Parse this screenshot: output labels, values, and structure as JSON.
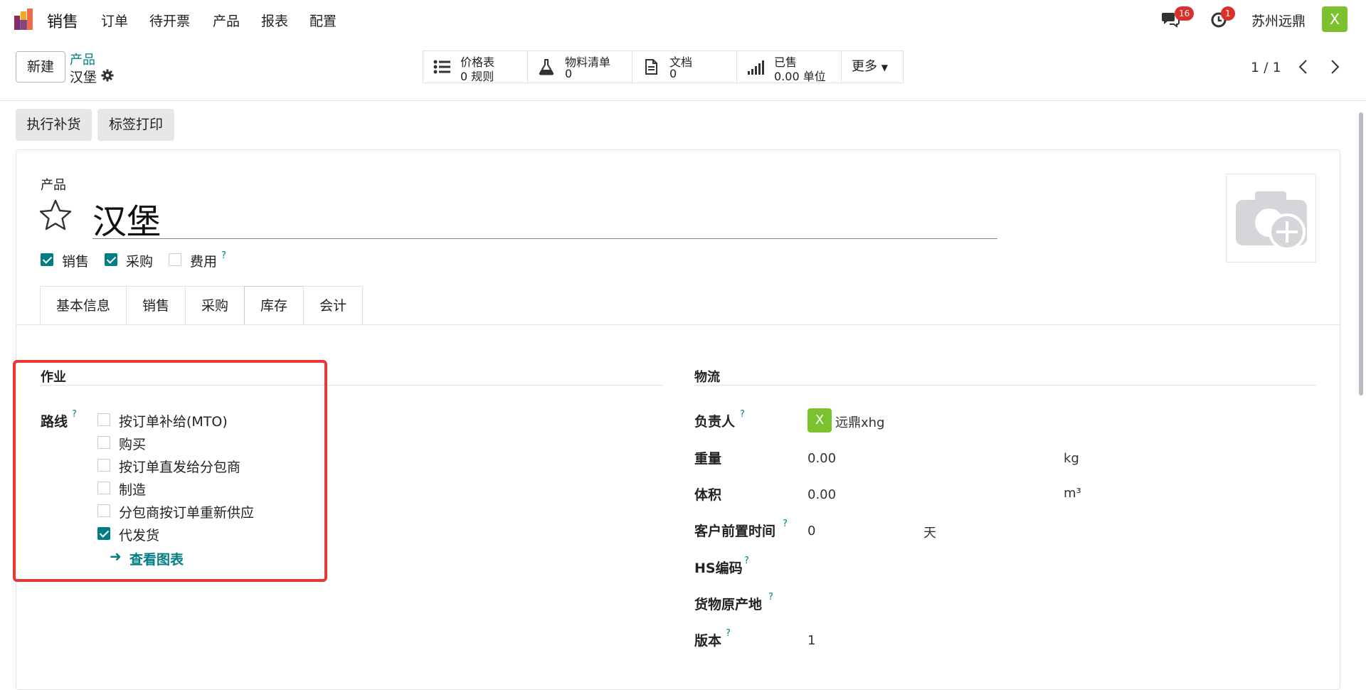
{
  "topnav": {
    "app": "销售",
    "menu": [
      "订单",
      "待开票",
      "产品",
      "报表",
      "配置"
    ],
    "messages_badge": "16",
    "activities_badge": "1",
    "company": "苏州远鼎",
    "user_initial": "X"
  },
  "control": {
    "new_button": "新建",
    "breadcrumb_parent": "产品",
    "breadcrumb_current": "汉堡",
    "smart_buttons": [
      {
        "label": "价格表",
        "value": "0 规则",
        "icon": "list-icon"
      },
      {
        "label": "物料清单",
        "value": "0",
        "icon": "flask-icon"
      },
      {
        "label": "文档",
        "value": "0",
        "icon": "document-icon"
      },
      {
        "label": "已售",
        "value": "0.00 单位",
        "icon": "bar-chart-icon"
      }
    ],
    "more_label": "更多",
    "pager": "1 / 1"
  },
  "actions": {
    "replenish": "执行补货",
    "print_labels": "标签打印"
  },
  "form": {
    "name_label": "产品",
    "name": "汉堡",
    "flags": [
      {
        "label": "销售",
        "checked": true
      },
      {
        "label": "采购",
        "checked": true
      },
      {
        "label": "费用",
        "checked": false
      }
    ],
    "tabs": [
      "基本信息",
      "销售",
      "采购",
      "库存",
      "会计"
    ],
    "active_tab": "库存",
    "operations": {
      "title": "作业",
      "routes_label": "路线",
      "routes": [
        {
          "label": "按订单补给(MTO)",
          "checked": false
        },
        {
          "label": "购买",
          "checked": false
        },
        {
          "label": "按订单直发给分包商",
          "checked": false
        },
        {
          "label": "制造",
          "checked": false
        },
        {
          "label": "分包商按订单重新供应",
          "checked": false
        },
        {
          "label": "代发货",
          "checked": true
        }
      ],
      "view_diagram": "查看图表"
    },
    "logistics": {
      "title": "物流",
      "responsible_label": "负责人",
      "responsible_initial": "X",
      "responsible": "远鼎xhg",
      "weight_label": "重量",
      "weight": "0.00",
      "weight_unit": "kg",
      "volume_label": "体积",
      "volume": "0.00",
      "volume_unit": "m³",
      "lead_time_label": "客户前置时间",
      "lead_time": "0",
      "lead_time_unit": "天",
      "hs_code_label": "HS编码",
      "origin_label": "货物原产地",
      "version_label": "版本",
      "version": "1"
    }
  },
  "colors": {
    "primary": "#017e84",
    "badge": "#d9302c",
    "avatar": "#7cc22f",
    "highlight": "#e53935"
  }
}
